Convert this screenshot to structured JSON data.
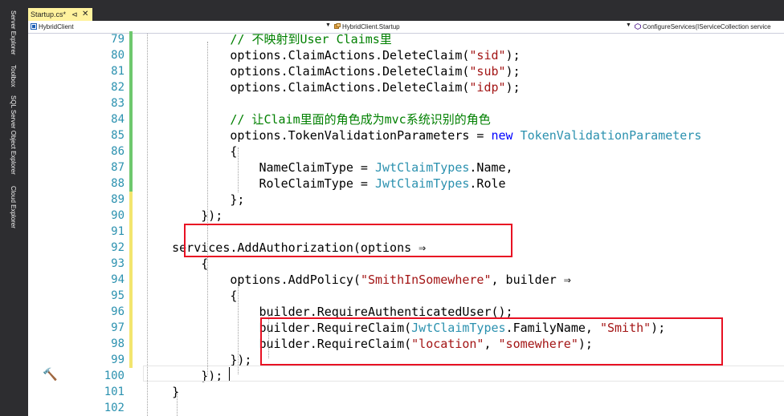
{
  "sidebar": {
    "items": [
      "Server Explorer",
      "Toolbox",
      "SQL Server Object Explorer",
      "Cloud Explorer"
    ]
  },
  "tab": {
    "label": "Startup.cs*",
    "pin": "⊲",
    "close": "✕"
  },
  "nav": {
    "project": "HybridClient",
    "type": "HybridClient.Startup",
    "member": "ConfigureServices(IServiceCollection service"
  },
  "colors": {
    "accent_tab": "#fff29d",
    "changed_bar": "#6ec86e",
    "saved_bar": "#f3e56f",
    "highlight_box": "#e81123"
  },
  "code": {
    "lines": [
      {
        "n": "79",
        "parts": [
          [
            "cmt",
            "            // 不映射到User Claims里"
          ]
        ]
      },
      {
        "n": "80",
        "parts": [
          [
            "p",
            "            options.ClaimActions.DeleteClaim("
          ],
          [
            "str",
            "\"sid\""
          ],
          [
            "p",
            ");"
          ]
        ]
      },
      {
        "n": "81",
        "parts": [
          [
            "p",
            "            options.ClaimActions.DeleteClaim("
          ],
          [
            "str",
            "\"sub\""
          ],
          [
            "p",
            ");"
          ]
        ]
      },
      {
        "n": "82",
        "parts": [
          [
            "p",
            "            options.ClaimActions.DeleteClaim("
          ],
          [
            "str",
            "\"idp\""
          ],
          [
            "p",
            ");"
          ]
        ]
      },
      {
        "n": "83",
        "parts": [
          [
            "p",
            ""
          ]
        ]
      },
      {
        "n": "84",
        "parts": [
          [
            "cmt",
            "            // 让Claim里面的角色成为mvc系统识别的角色"
          ]
        ]
      },
      {
        "n": "85",
        "parts": [
          [
            "p",
            "            options.TokenValidationParameters = "
          ],
          [
            "kw",
            "new"
          ],
          [
            "p",
            " "
          ],
          [
            "type",
            "TokenValidationParameters"
          ]
        ]
      },
      {
        "n": "86",
        "parts": [
          [
            "p",
            "            {"
          ]
        ]
      },
      {
        "n": "87",
        "parts": [
          [
            "p",
            "                NameClaimType = "
          ],
          [
            "type",
            "JwtClaimTypes"
          ],
          [
            "p",
            ".Name,"
          ]
        ]
      },
      {
        "n": "88",
        "parts": [
          [
            "p",
            "                RoleClaimType = "
          ],
          [
            "type",
            "JwtClaimTypes"
          ],
          [
            "p",
            ".Role"
          ]
        ]
      },
      {
        "n": "89",
        "parts": [
          [
            "p",
            "            };"
          ]
        ]
      },
      {
        "n": "90",
        "parts": [
          [
            "p",
            "        });"
          ]
        ]
      },
      {
        "n": "91",
        "parts": [
          [
            "p",
            ""
          ]
        ]
      },
      {
        "n": "92",
        "parts": [
          [
            "p",
            "    services.AddAuthorization(options ⇒"
          ]
        ]
      },
      {
        "n": "93",
        "parts": [
          [
            "p",
            "        {"
          ]
        ]
      },
      {
        "n": "94",
        "parts": [
          [
            "p",
            "            options.AddPolicy("
          ],
          [
            "str",
            "\"SmithInSomewhere\""
          ],
          [
            "p",
            ", builder ⇒"
          ]
        ]
      },
      {
        "n": "95",
        "parts": [
          [
            "p",
            "            {"
          ]
        ]
      },
      {
        "n": "96",
        "parts": [
          [
            "p",
            "                builder.RequireAuthenticatedUser();"
          ]
        ]
      },
      {
        "n": "97",
        "parts": [
          [
            "p",
            "                builder.RequireClaim("
          ],
          [
            "type",
            "JwtClaimTypes"
          ],
          [
            "p",
            ".FamilyName, "
          ],
          [
            "str",
            "\"Smith\""
          ],
          [
            "p",
            ");"
          ]
        ]
      },
      {
        "n": "98",
        "parts": [
          [
            "p",
            "                builder.RequireClaim("
          ],
          [
            "str",
            "\"location\""
          ],
          [
            "p",
            ", "
          ],
          [
            "str",
            "\"somewhere\""
          ],
          [
            "p",
            ");"
          ]
        ]
      },
      {
        "n": "99",
        "parts": [
          [
            "p",
            "            });"
          ]
        ]
      },
      {
        "n": "100",
        "parts": [
          [
            "p",
            "        });"
          ]
        ]
      },
      {
        "n": "101",
        "parts": [
          [
            "p",
            "    }"
          ]
        ]
      },
      {
        "n": "102",
        "parts": [
          [
            "p",
            ""
          ]
        ]
      }
    ],
    "change_bars": [
      "green",
      "green",
      "green",
      "green",
      "green",
      "green",
      "green",
      "green",
      "green",
      "green",
      "yellow",
      "yellow",
      "yellow",
      "yellow",
      "yellow",
      "yellow",
      "yellow",
      "yellow",
      "yellow",
      "yellow",
      "yellow",
      "none",
      "none",
      "none"
    ]
  }
}
